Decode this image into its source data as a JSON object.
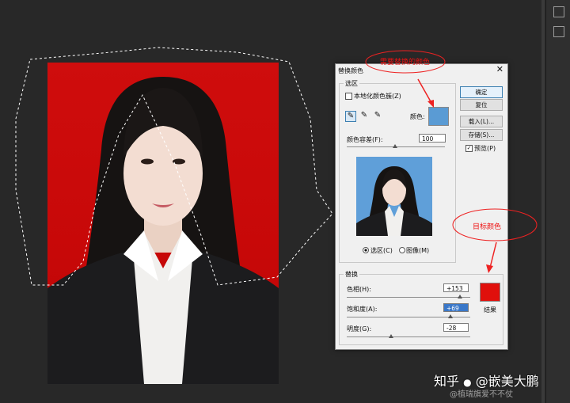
{
  "dialog": {
    "title": "替换颜色",
    "selection_group": "选区",
    "localized_clusters_label": "本地化颜色簇(Z)",
    "color_label": "颜色:",
    "fuzziness_label": "颜色容差(F):",
    "fuzziness_value": "100",
    "selection_radio": "选区(C)",
    "image_radio": "图像(M)",
    "replace_group": "替换",
    "hue_label": "色相(H):",
    "hue_value": "+153",
    "saturation_label": "饱和度(A):",
    "saturation_value": "+69",
    "lightness_label": "明度(G):",
    "lightness_value": "-28",
    "result_label": "结果",
    "ok_button": "确定",
    "reset_button": "复位",
    "load_button": "载入(L)...",
    "save_button": "存储(S)...",
    "preview_label": "预览(P)",
    "selected_color": "#5a9bd4",
    "result_color": "#e0100c"
  },
  "annotations": {
    "top_note": "需要替换的颜色",
    "target_note": "目标颜色"
  },
  "watermark": {
    "brand": "知乎",
    "account": "@嵌美大鹏",
    "sub": "@植瑞旗爱不不仗"
  }
}
